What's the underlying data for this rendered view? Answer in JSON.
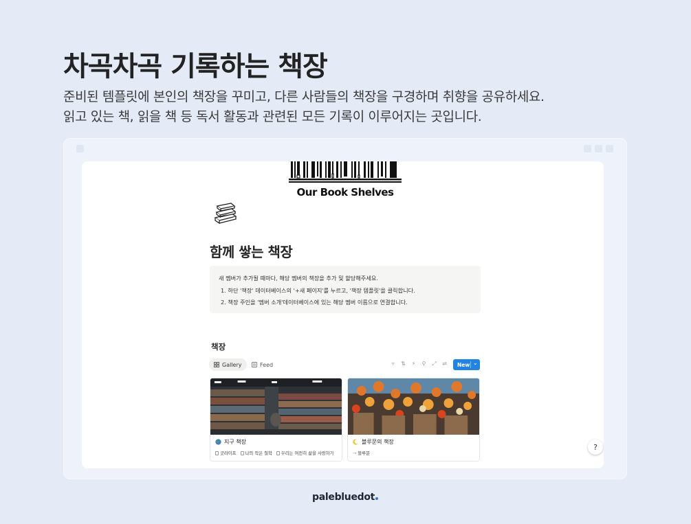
{
  "hero": {
    "title": "차곡차곡 기록하는 책장",
    "subtitle_line1": "준비된 템플릿에 본인의 책장을 꾸미고, 다른 사람들의 책장을 구경하며 취향을 공유하세요.",
    "subtitle_line2": "읽고 있는 책, 읽을 책 등 독서 활동과 관련된 모든 기록이 이루어지는 곳입니다."
  },
  "page": {
    "cover_title": "Our Book Shelves",
    "title": "함께 쌓는 책장",
    "callout": {
      "intro": "새 멤버가 추가될 때마다, 해당 멤버의 책장을 추가 및 할당해주세요.",
      "steps": [
        "1.   하단 '책장' 데이터베이스의 '+새 페이지'를 누르고, '책장 템플릿'을 클릭합니다.",
        "2.   책장 주인을 '멤버 소개'데이터베이스에 있는 해당 멤버 이름으로 연결합니다."
      ]
    },
    "database": {
      "title": "책장",
      "tabs": [
        "Gallery",
        "Feed"
      ],
      "new_label": "New",
      "toolbar_icons": [
        "filter-icon",
        "sort-icon",
        "automation-icon",
        "search-icon",
        "expand-icon",
        "settings-icon"
      ],
      "cards": [
        {
          "icon": "globe-icon",
          "title": "지구 책장",
          "props": [
            "굿라이프",
            "나의 작은 철학",
            "우리는 여전히 삶을 사랑하가"
          ]
        },
        {
          "icon": "moon-icon",
          "title": "블루문의 책장",
          "props": [
            "블루문"
          ]
        }
      ]
    },
    "help_label": "?"
  },
  "brand": "palebluedot",
  "colors": {
    "background": "#e4ebf7",
    "accent": "#2383e2",
    "brand_dot": "#3e73d6"
  }
}
